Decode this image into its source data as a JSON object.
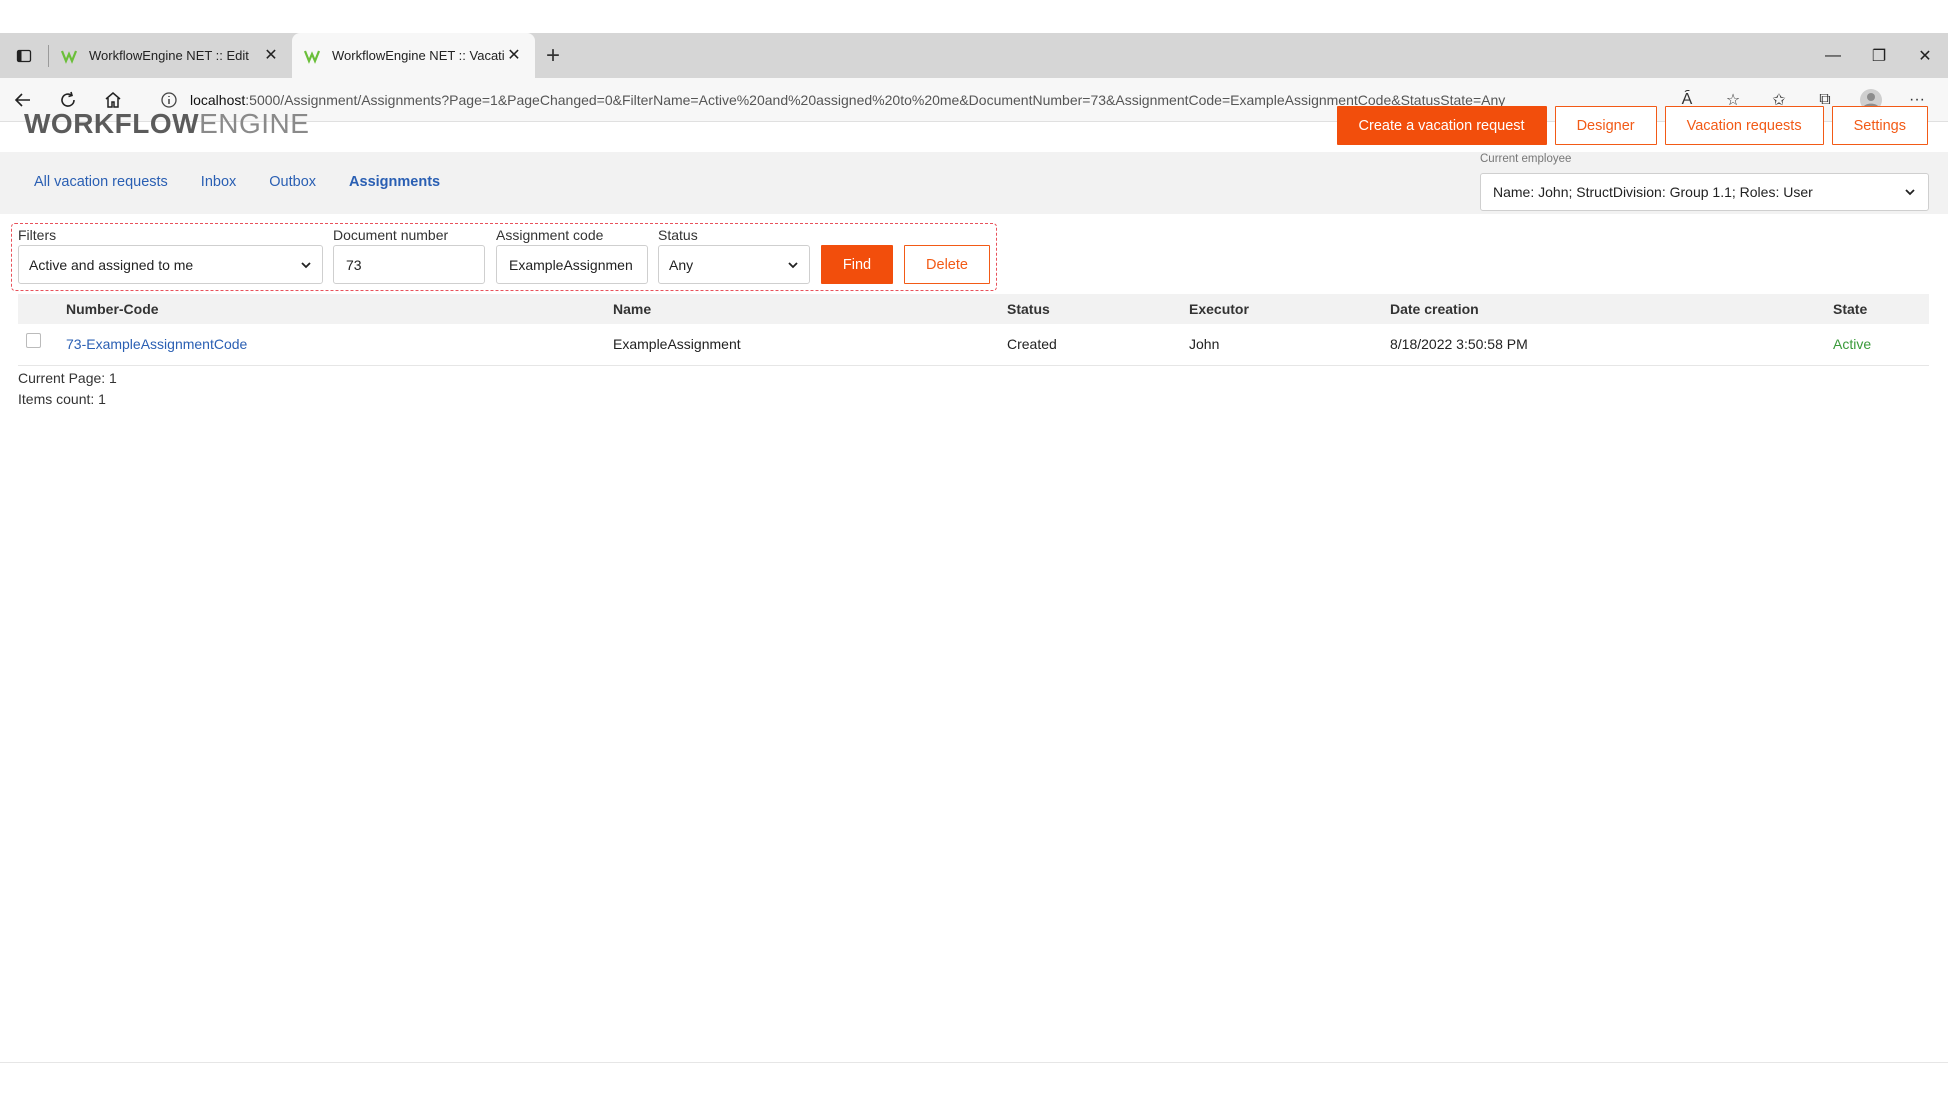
{
  "browser": {
    "tabs": [
      {
        "title": "WorkflowEngine NET :: Edit",
        "active": false
      },
      {
        "title": "WorkflowEngine NET :: Vacation",
        "active": true
      }
    ],
    "address": {
      "host": "localhost",
      "path": ":5000/Assignment/Assignments?Page=1&PageChanged=0&FilterName=Active%20and%20assigned%20to%20me&DocumentNumber=73&AssignmentCode=ExampleAssignmentCode&StatusState=Any"
    }
  },
  "logo": {
    "part1": "WORKFLOW",
    "part2": "ENGINE"
  },
  "top_buttons": {
    "create": "Create a vacation request",
    "designer": "Designer",
    "vacation_requests": "Vacation requests",
    "settings": "Settings"
  },
  "menu": {
    "all": "All vacation requests",
    "inbox": "Inbox",
    "outbox": "Outbox",
    "assignments": "Assignments"
  },
  "employee": {
    "label": "Current employee",
    "value": "Name: John; StructDivision: Group 1.1; Roles: User"
  },
  "filters": {
    "filters_label": "Filters",
    "filters_value": "Active and assigned to me",
    "docnum_label": "Document number",
    "docnum_value": "73",
    "code_label": "Assignment code",
    "code_value": "ExampleAssignmen",
    "status_label": "Status",
    "status_value": "Any",
    "find": "Find",
    "delete": "Delete"
  },
  "table": {
    "headers": {
      "number_code": "Number-Code",
      "name": "Name",
      "status": "Status",
      "executor": "Executor",
      "date": "Date creation",
      "state": "State"
    },
    "rows": [
      {
        "number_code": "73-ExampleAssignmentCode",
        "name": "ExampleAssignment",
        "status": "Created",
        "executor": "John",
        "date": "8/18/2022 3:50:58 PM",
        "state": "Active"
      }
    ]
  },
  "pager": {
    "current_page": "Current Page: 1",
    "items_count": "Items count: 1"
  },
  "colors": {
    "accent": "#f24e0c",
    "link": "#2a5fb3",
    "active_state": "#3a9a3a"
  }
}
